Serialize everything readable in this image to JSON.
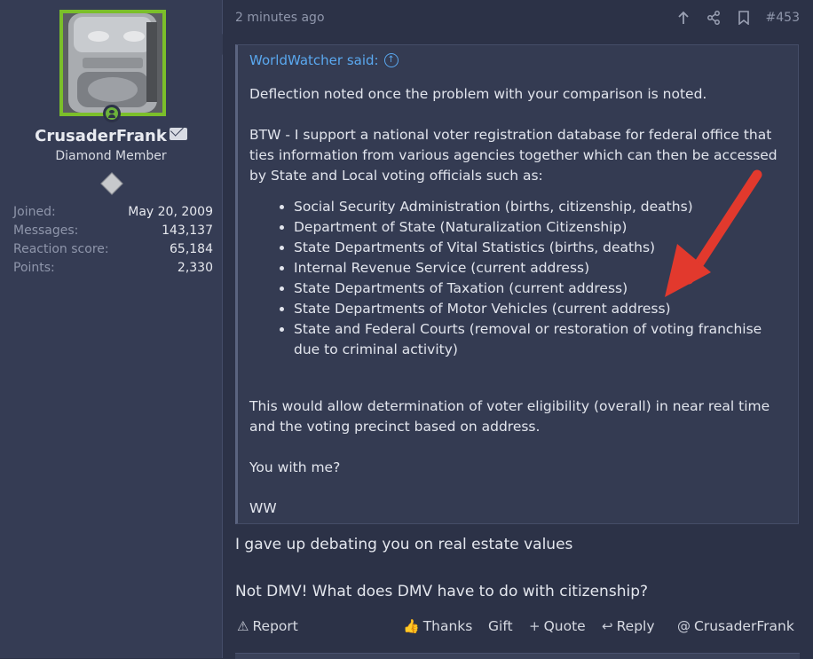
{
  "user": {
    "name": "CrusaderFrank",
    "title": "Diamond Member",
    "stats": [
      {
        "label": "Joined:",
        "value": "May 20, 2009"
      },
      {
        "label": "Messages:",
        "value": "143,137"
      },
      {
        "label": "Reaction score:",
        "value": "65,184"
      },
      {
        "label": "Points:",
        "value": "2,330"
      }
    ]
  },
  "post": {
    "time": "2 minutes ago",
    "number": "#453",
    "quote": {
      "author": "WorldWatcher said:",
      "para1": "Deflection noted once the problem with your comparison is noted.",
      "para2": "BTW - I support a national voter registration database for federal office that ties information from various agencies together which can then be accessed by State and Local voting officials such as:",
      "items": [
        "Social Security Administration (births, citizenship, deaths)",
        "Department of State (Naturalization Citizenship)",
        "State Departments of Vital Statistics (births, deaths)",
        "Internal Revenue Service (current address)",
        "State Departments of Taxation (current address)",
        "State Departments of Motor Vehicles (current address)",
        "State and Federal Courts (removal or restoration of voting franchise due to criminal activity)"
      ],
      "para3": "This would allow determination of voter eligibility (overall) in near real time and the voting precinct based on address.",
      "para4": "You with me?",
      "para5": "WW"
    },
    "reply_lines": [
      "I gave up debating you on real estate values",
      "Not DMV! What does DMV have to do with citizenship?"
    ]
  },
  "actions": {
    "report": "Report",
    "thanks": "Thanks",
    "gift": "Gift",
    "quote": "Quote",
    "reply": "Reply",
    "mention": "CrusaderFrank"
  },
  "colors": {
    "accent_link": "#5aa8ef",
    "avatar_border": "#7bbf2a",
    "annotation_arrow": "#e2392d"
  }
}
